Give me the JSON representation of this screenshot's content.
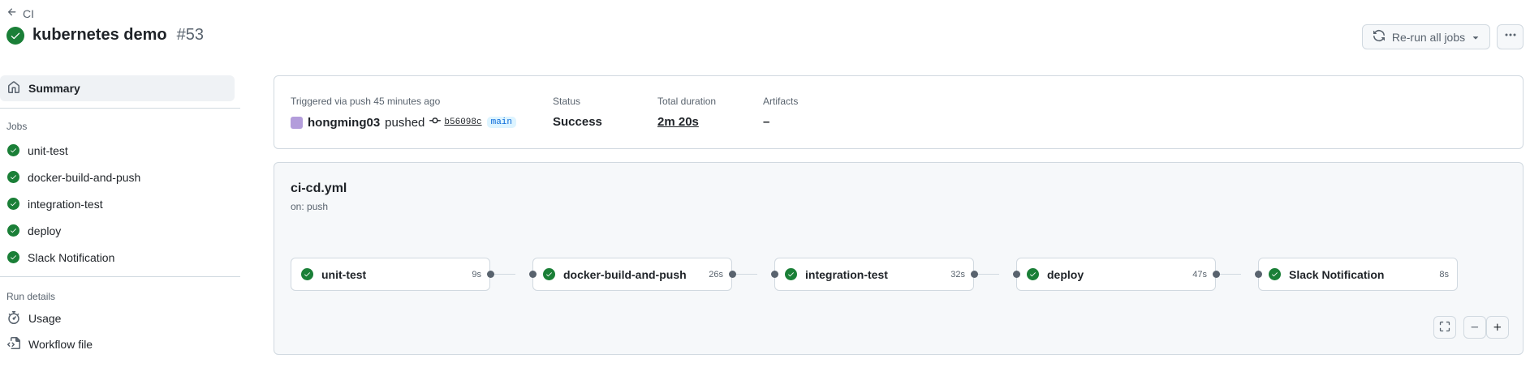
{
  "nav": {
    "back_label": "CI"
  },
  "run": {
    "title": "kubernetes demo",
    "number": "#53"
  },
  "actions": {
    "rerun_label": "Re-run all jobs"
  },
  "sidebar": {
    "summary_label": "Summary",
    "jobs_heading": "Jobs",
    "jobs": [
      {
        "label": "unit-test"
      },
      {
        "label": "docker-build-and-push"
      },
      {
        "label": "integration-test"
      },
      {
        "label": "deploy"
      },
      {
        "label": "Slack Notification"
      }
    ],
    "run_details_heading": "Run details",
    "details": [
      {
        "label": "Usage",
        "icon": "stopwatch-icon"
      },
      {
        "label": "Workflow file",
        "icon": "file-code-icon"
      }
    ]
  },
  "summary": {
    "trigger_label": "Triggered via push 45 minutes ago",
    "actor": "hongming03",
    "action": "pushed",
    "commit": "b56098c",
    "branch": "main",
    "status_label": "Status",
    "status_value": "Success",
    "duration_label": "Total duration",
    "duration_value": "2m 20s",
    "artifacts_label": "Artifacts",
    "artifacts_value": "–"
  },
  "workflow": {
    "file": "ci-cd.yml",
    "on": "on: push",
    "jobs": [
      {
        "name": "unit-test",
        "duration": "9s"
      },
      {
        "name": "docker-build-and-push",
        "duration": "26s"
      },
      {
        "name": "integration-test",
        "duration": "32s"
      },
      {
        "name": "deploy",
        "duration": "47s"
      },
      {
        "name": "Slack Notification",
        "duration": "8s"
      }
    ]
  },
  "colors": {
    "success": "#1a7f37",
    "accent": "#0969da",
    "border": "#d1d9e0"
  }
}
